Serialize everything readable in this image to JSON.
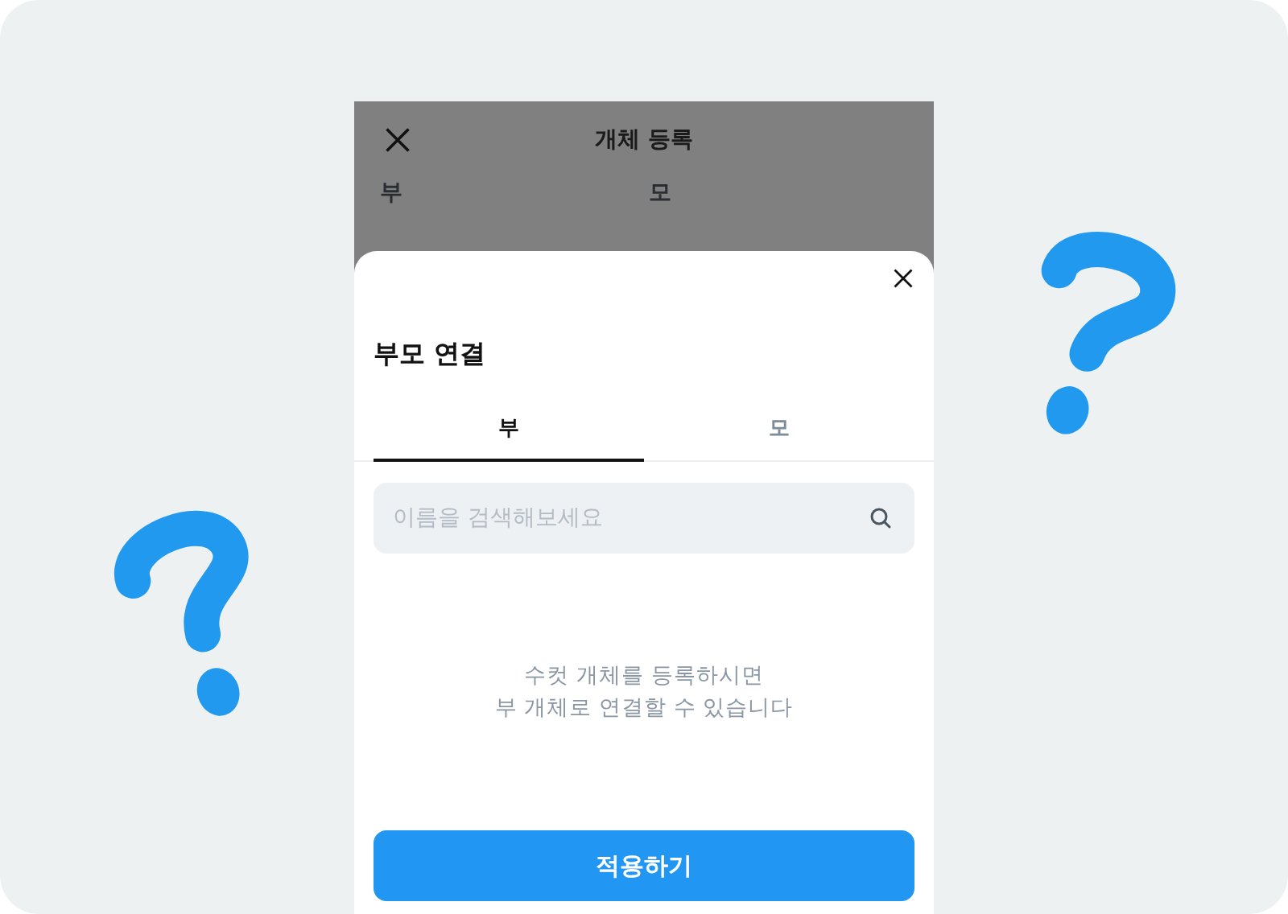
{
  "header": {
    "title": "개체 등록",
    "columns": [
      "부",
      "모"
    ]
  },
  "sheet": {
    "title": "부모 연결",
    "tabs": [
      {
        "label": "부",
        "selected": true
      },
      {
        "label": "모",
        "selected": false
      }
    ],
    "search": {
      "placeholder": "이름을 검색해보세요"
    },
    "empty_message": "수컷 개체를 등록하시면\n부 개체로 연결할 수 있습니다",
    "apply_button": "적용하기"
  }
}
